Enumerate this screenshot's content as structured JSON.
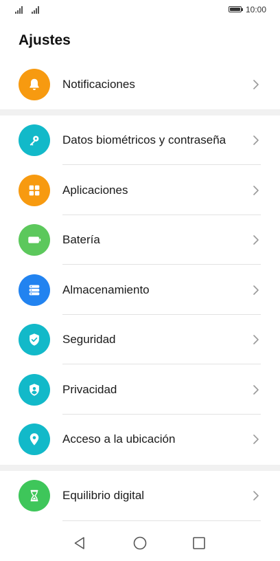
{
  "status_bar": {
    "time": "10:00"
  },
  "page": {
    "title": "Ajustes"
  },
  "settings": {
    "notifications": {
      "label": "Notificaciones",
      "icon": "bell-icon",
      "color": "#f79a10"
    },
    "biometrics": {
      "label": "Datos biométricos y contraseña",
      "icon": "key-icon",
      "color": "#12b9c9"
    },
    "apps": {
      "label": "Aplicaciones",
      "icon": "apps-grid-icon",
      "color": "#f79a10"
    },
    "battery": {
      "label": "Batería",
      "icon": "battery-icon",
      "color": "#5cc85c"
    },
    "storage": {
      "label": "Almacenamiento",
      "icon": "storage-icon",
      "color": "#2283f0"
    },
    "security": {
      "label": "Seguridad",
      "icon": "shield-check-icon",
      "color": "#12b9c9"
    },
    "privacy": {
      "label": "Privacidad",
      "icon": "privacy-shield-icon",
      "color": "#12b9c9"
    },
    "location": {
      "label": "Acceso a la ubicación",
      "icon": "location-pin-icon",
      "color": "#12b9c9"
    },
    "digital_balance": {
      "label": "Equilibrio digital",
      "icon": "hourglass-icon",
      "color": "#3ec65a"
    }
  }
}
